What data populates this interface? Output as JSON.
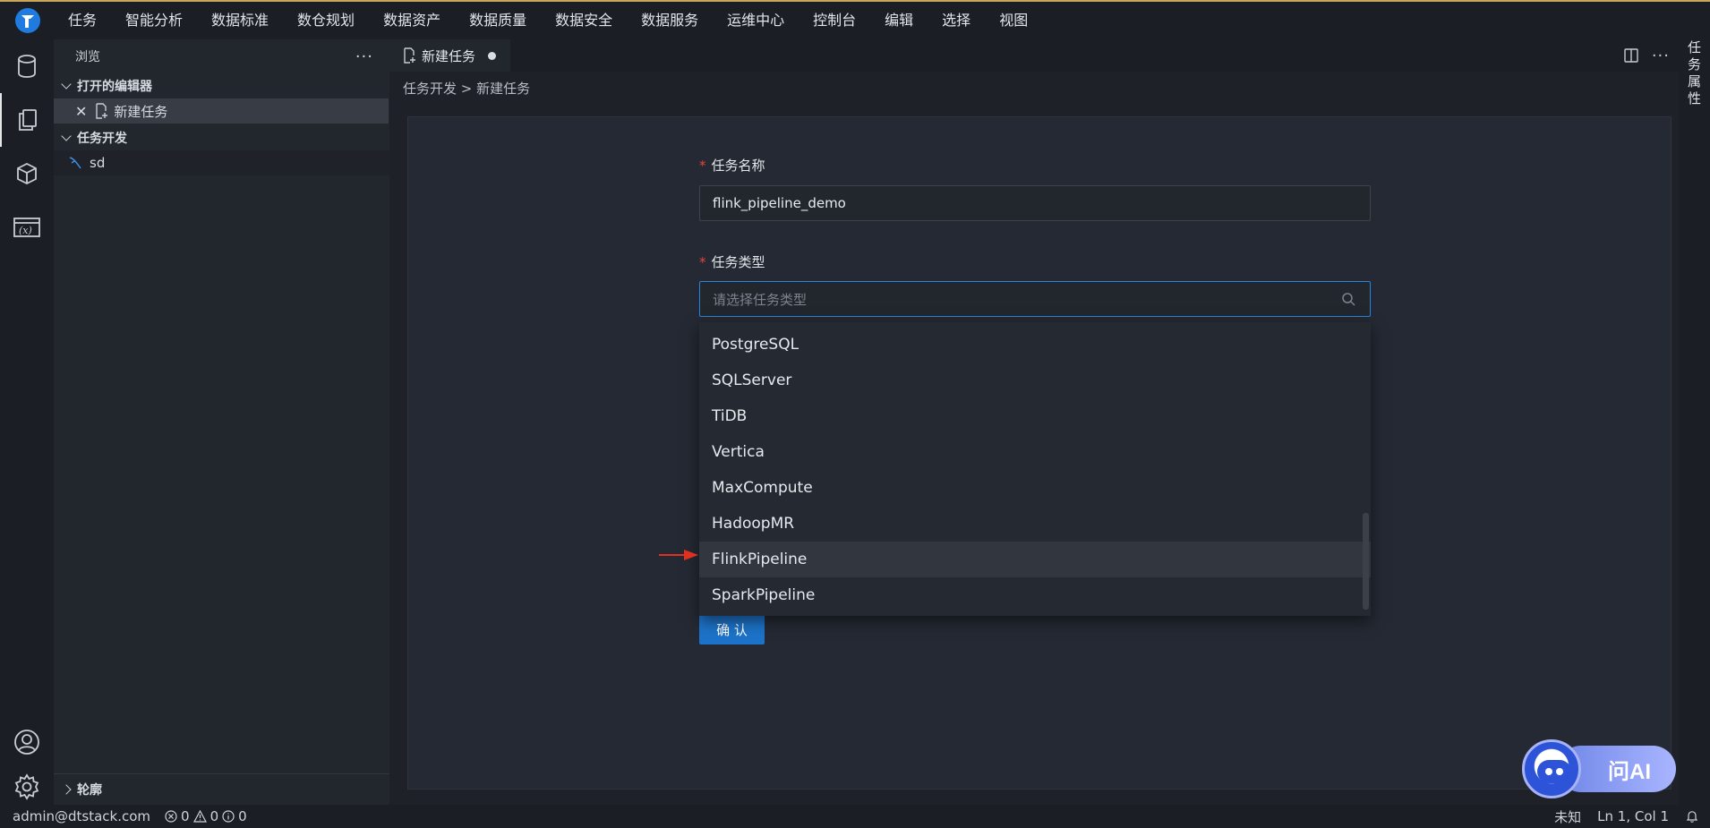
{
  "menu": [
    "任务",
    "智能分析",
    "数据标准",
    "数仓规划",
    "数据资产",
    "数据质量",
    "数据安全",
    "数据服务",
    "运维中心",
    "控制台",
    "编辑",
    "选择",
    "视图"
  ],
  "sidebar": {
    "title": "浏览",
    "open_editors_label": "打开的编辑器",
    "open_editors": [
      {
        "label": "新建任务"
      }
    ],
    "task_dev_label": "任务开发",
    "task_dev_items": [
      {
        "label": "sd"
      }
    ],
    "outline_label": "轮廓"
  },
  "tab": {
    "label": "新建任务"
  },
  "breadcrumb": {
    "part1": "任务开发",
    "sep": ">",
    "part2": "新建任务"
  },
  "form": {
    "name_label": "任务名称",
    "name_value": "flink_pipeline_demo",
    "type_label": "任务类型",
    "type_placeholder": "请选择任务类型",
    "options": [
      "PostgreSQL",
      "SQLServer",
      "TiDB",
      "Vertica",
      "MaxCompute",
      "HadoopMR",
      "FlinkPipeline",
      "SparkPipeline"
    ],
    "hovered_option": "FlinkPipeline",
    "confirm_label": "确 认"
  },
  "rightbar": {
    "label": "任务属性"
  },
  "status": {
    "user": "admin@dtstack.com",
    "errors": "0",
    "warnings": "0",
    "info": "0",
    "lang": "未知",
    "position": "Ln 1, Col 1"
  },
  "ai_button": {
    "label": "问AI"
  },
  "colors": {
    "accent": "#1d73c9",
    "required": "#e0463c",
    "focus_border": "#2b84d9"
  }
}
